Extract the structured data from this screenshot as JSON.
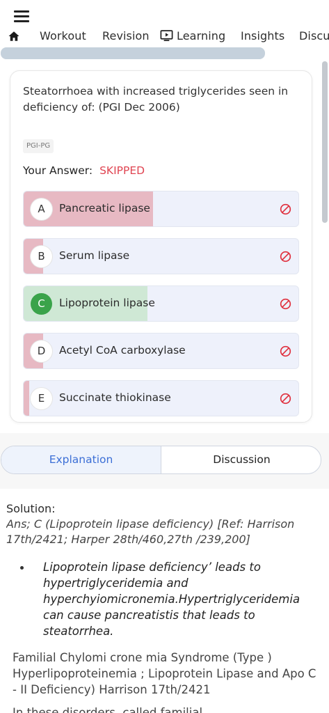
{
  "nav": {
    "tabs": [
      {
        "label": "Workout"
      },
      {
        "label": "Revision"
      },
      {
        "label": "Learning"
      },
      {
        "label": "Insights"
      },
      {
        "label": "Discu"
      }
    ]
  },
  "question": {
    "text": "Steatorrhoea with increased triglycerides seen in deficiency of: (PGI Dec 2006)",
    "tag": "PGI-PG",
    "your_answer_label": "Your Answer:",
    "your_answer_value": "SKIPPED",
    "options": [
      {
        "letter": "A",
        "text": "Pancreatic lipase",
        "response_fraction": 0.47,
        "status": "wrong"
      },
      {
        "letter": "B",
        "text": "Serum lipase",
        "response_fraction": 0.07,
        "status": "wrong"
      },
      {
        "letter": "C",
        "text": "Lipoprotein lipase",
        "response_fraction": 0.45,
        "status": "correct"
      },
      {
        "letter": "D",
        "text": "Acetyl CoA carboxylase",
        "response_fraction": 0.07,
        "status": "wrong"
      },
      {
        "letter": "E",
        "text": "Succinate thiokinase",
        "response_fraction": 0.02,
        "status": "wrong"
      }
    ]
  },
  "tabs2": {
    "explanation": "Explanation",
    "discussion": "Discussion"
  },
  "solution": {
    "label": "Solution:",
    "ans_line1": "Ans; C (Lipoprotein lipase deficiency) [Ref: Harrison",
    "ans_line2": "17th/2421; Harper 28th/460,27th /239,200]",
    "bullet": "Lipoprotein lipase deficiency’ leads to hypertriglyceridemia and hyperchyiomicronemia.Hypertriglyceridemia can cause pancreatistis that leads to steatorrhea.",
    "para": "Familial Chylomi crone mia Syndrome (Type ) Hyperlipoproteinemia ; Lipoprotein Lipase and Apo C - II Deficiency) Harrison 17th/2421",
    "cut": "In these disorders, called familial"
  },
  "colors": {
    "wrong_fill": "#e7b9c3",
    "correct_fill": "#cfe8d5",
    "correct_badge": "#3aa34a",
    "skipped": "#e04552",
    "accent": "#3c6fd6"
  }
}
